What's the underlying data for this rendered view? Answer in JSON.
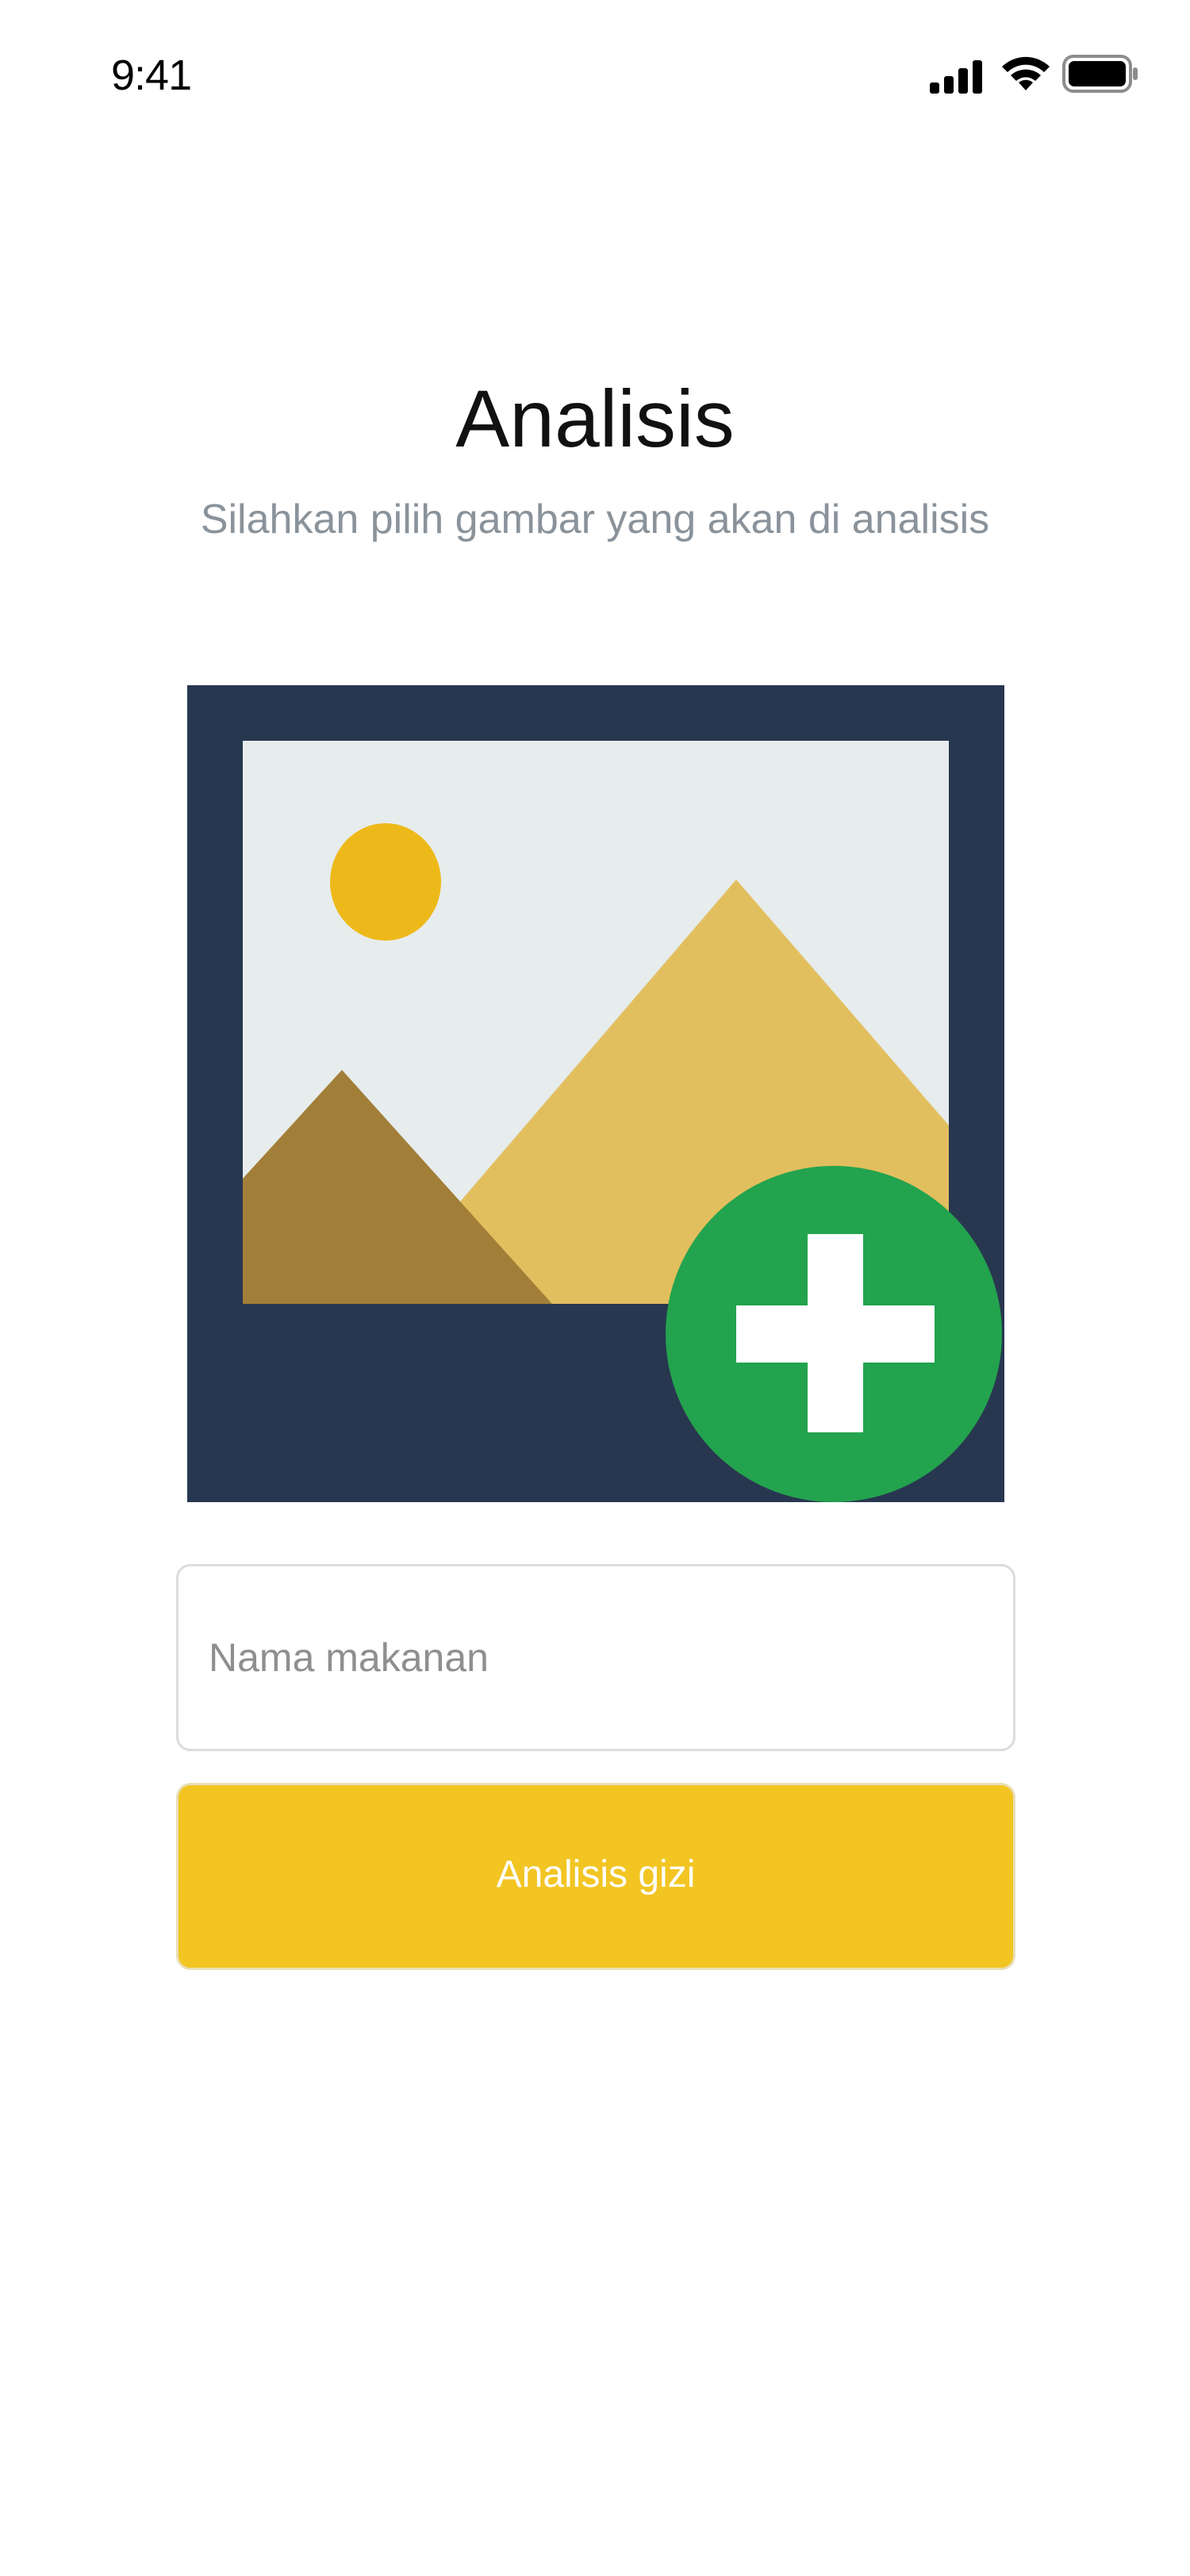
{
  "status_bar": {
    "time": "9:41",
    "icons": [
      "signal-icon",
      "wifi-icon",
      "battery-icon"
    ]
  },
  "header": {
    "title": "Analisis",
    "subtitle": "Silahkan pilih gambar yang akan di analisis"
  },
  "image_picker": {
    "icon": "add-image-icon",
    "colors": {
      "frame": "#283750",
      "sky": "#e7ecec",
      "sun": "#edb91a",
      "mountain_large": "#e2bf5e",
      "mountain_small": "#a27f38",
      "add_circle": "#23a34e",
      "plus": "#ffffff"
    }
  },
  "form": {
    "food_name_placeholder": "Nama makanan",
    "food_name_value": "",
    "analyze_button_label": "Analisis gizi"
  },
  "colors": {
    "accent": "#f2c523",
    "subtitle": "#8a939b",
    "input_border": "#dcdcdc"
  }
}
